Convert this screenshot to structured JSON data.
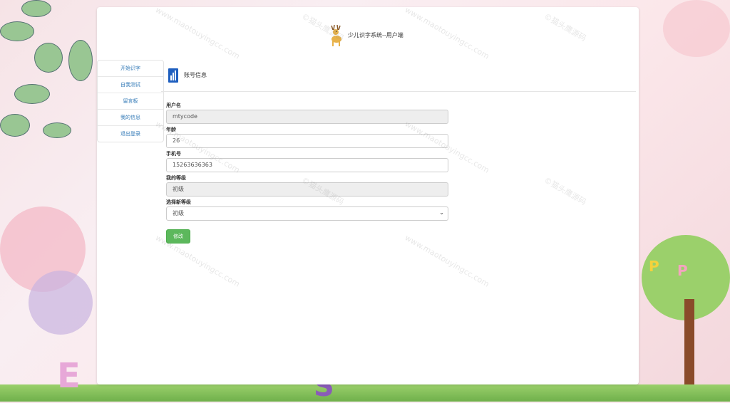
{
  "header": {
    "title": "少儿识字系统--用户端"
  },
  "sidebar": {
    "items": [
      {
        "label": "开始识字"
      },
      {
        "label": "自我测试"
      },
      {
        "label": "留言板"
      },
      {
        "label": "我的信息"
      },
      {
        "label": "退出登录"
      }
    ]
  },
  "section": {
    "title": "账号信息"
  },
  "form": {
    "username": {
      "label": "用户名",
      "value": "mtycode"
    },
    "age": {
      "label": "年龄",
      "value": "26"
    },
    "phone": {
      "label": "手机号",
      "value": "15263636363"
    },
    "level": {
      "label": "我的等级",
      "value": "初级"
    },
    "new_level": {
      "label": "选择新等级",
      "selected": "初级"
    },
    "submit_label": "修改"
  },
  "watermark": {
    "text_cn": "©猫头鹰源码",
    "text_url": "www.maotouyingcc.com"
  },
  "colors": {
    "accent": "#5cb85c",
    "link": "#337ab7",
    "readonly_bg": "#eeeeee"
  }
}
